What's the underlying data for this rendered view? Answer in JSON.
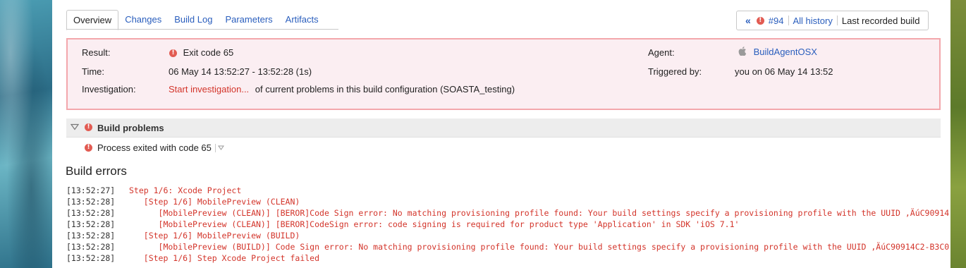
{
  "tabs": [
    {
      "label": "Overview",
      "active": true
    },
    {
      "label": "Changes",
      "active": false
    },
    {
      "label": "Build Log",
      "active": false
    },
    {
      "label": "Parameters",
      "active": false
    },
    {
      "label": "Artifacts",
      "active": false
    }
  ],
  "history_nav": {
    "prev_symbol": "«",
    "build_number": "#94",
    "all_history": "All history",
    "last_recorded": "Last recorded build"
  },
  "summary": {
    "result_label": "Result:",
    "result_value": "Exit code 65",
    "time_label": "Time:",
    "time_value": "06 May 14 13:52:27 - 13:52:28 (1s)",
    "investigation_label": "Investigation:",
    "investigation_link": "Start investigation...",
    "investigation_text": "of current problems in this build configuration (SOASTA_testing)",
    "agent_label": "Agent:",
    "agent_value": "BuildAgentOSX",
    "triggered_label": "Triggered by:",
    "triggered_value": "you on 06 May 14 13:52"
  },
  "problems": {
    "title": "Build problems",
    "items": [
      "Process exited with code 65"
    ]
  },
  "errors": {
    "title": "Build errors",
    "lines": [
      {
        "ts": "[13:52:27]",
        "msg": "Step 1/6: Xcode Project"
      },
      {
        "ts": "[13:52:28]",
        "msg": "   [Step 1/6] MobilePreview (CLEAN)"
      },
      {
        "ts": "[13:52:28]",
        "msg": "      [MobilePreview (CLEAN)] [BEROR]Code Sign error: No matching provisioning profile found: Your build settings specify a provisioning profile with the UUID ‚ÄúC90914"
      },
      {
        "ts": "[13:52:28]",
        "msg": "      [MobilePreview (CLEAN)] [BEROR]CodeSign error: code signing is required for product type 'Application' in SDK 'iOS 7.1'"
      },
      {
        "ts": "[13:52:28]",
        "msg": "   [Step 1/6] MobilePreview (BUILD)"
      },
      {
        "ts": "[13:52:28]",
        "msg": "      [MobilePreview (BUILD)] Code Sign error: No matching provisioning profile found: Your build settings specify a provisioning profile with the UUID ‚ÄúC90914C2-B3C0"
      },
      {
        "ts": "[13:52:28]",
        "msg": "   [Step 1/6] Step Xcode Project failed"
      }
    ]
  },
  "colors": {
    "link": "#2a5ebd",
    "error": "#d3342a",
    "summary_bg": "#fbeef2",
    "summary_border": "#f3a7ac"
  },
  "icons": {
    "error": "error-circle-icon",
    "agent": "apple-icon",
    "collapse": "triangle-down-icon"
  }
}
